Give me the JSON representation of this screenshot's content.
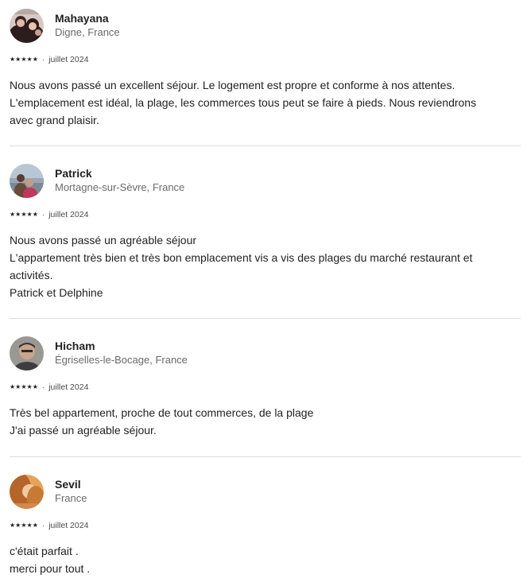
{
  "reviews": [
    {
      "name": "Mahayana",
      "location": "Digne, France",
      "stars": "★★★★★",
      "separator": "·",
      "date": "juillet 2024",
      "lines": [
        "Nous avons passé un excellent séjour. Le logement est propre et conforme à nos attentes.",
        "L'emplacement est idéal, la plage, les commerces tous peut se faire à pieds. Nous reviendrons",
        "avec grand plaisir."
      ]
    },
    {
      "name": "Patrick",
      "location": "Mortagne-sur-Sèvre, France",
      "stars": "★★★★★",
      "separator": "·",
      "date": "juillet 2024",
      "lines": [
        "Nous avons passé un agréable séjour",
        "L'appartement très bien et très bon emplacement vis a vis des plages du marché restaurant et",
        "activités.",
        "Patrick et Delphine"
      ]
    },
    {
      "name": "Hicham",
      "location": "Égriselles-le-Bocage, France",
      "stars": "★★★★★",
      "separator": "·",
      "date": "juillet 2024",
      "lines": [
        "Très bel appartement, proche de tout commerces, de la plage",
        "J'ai passé un agréable séjour."
      ]
    },
    {
      "name": "Sevil",
      "location": "France",
      "stars": "★★★★★",
      "separator": "·",
      "date": "juillet 2024",
      "lines": [
        "c'était parfait .",
        "merci pour tout ."
      ]
    }
  ],
  "rating": {
    "value": 5,
    "max": 5
  }
}
